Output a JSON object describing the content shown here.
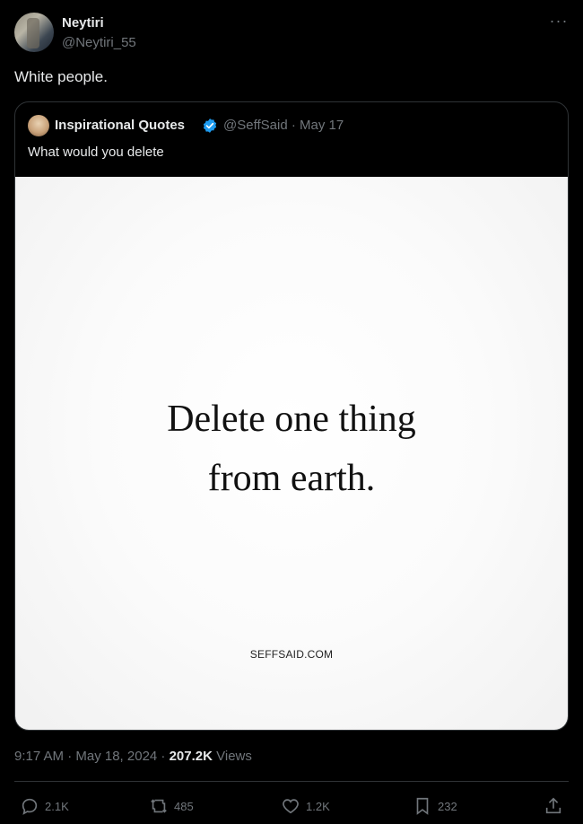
{
  "author": {
    "name": "Neytiri",
    "handle": "@Neytiri_55",
    "more_icon": "more-icon"
  },
  "tweet": {
    "text": "White people."
  },
  "quoted": {
    "name": "Inspirational Quotes",
    "handle_date": "@SeffSaid · May 17",
    "text": "What would you delete",
    "verified_color": "#1d9bf0",
    "image": {
      "line1": "Delete one thing",
      "line2": "from earth.",
      "site": "SEFFSAID.COM"
    }
  },
  "meta": {
    "time_date": "9:17 AM · May 18, 2024 · ",
    "views_count": "207.2K",
    "views_label": " Views"
  },
  "actions": {
    "replies": "2.1K",
    "reposts": "485",
    "likes": "1.2K",
    "bookmarks": "232"
  }
}
